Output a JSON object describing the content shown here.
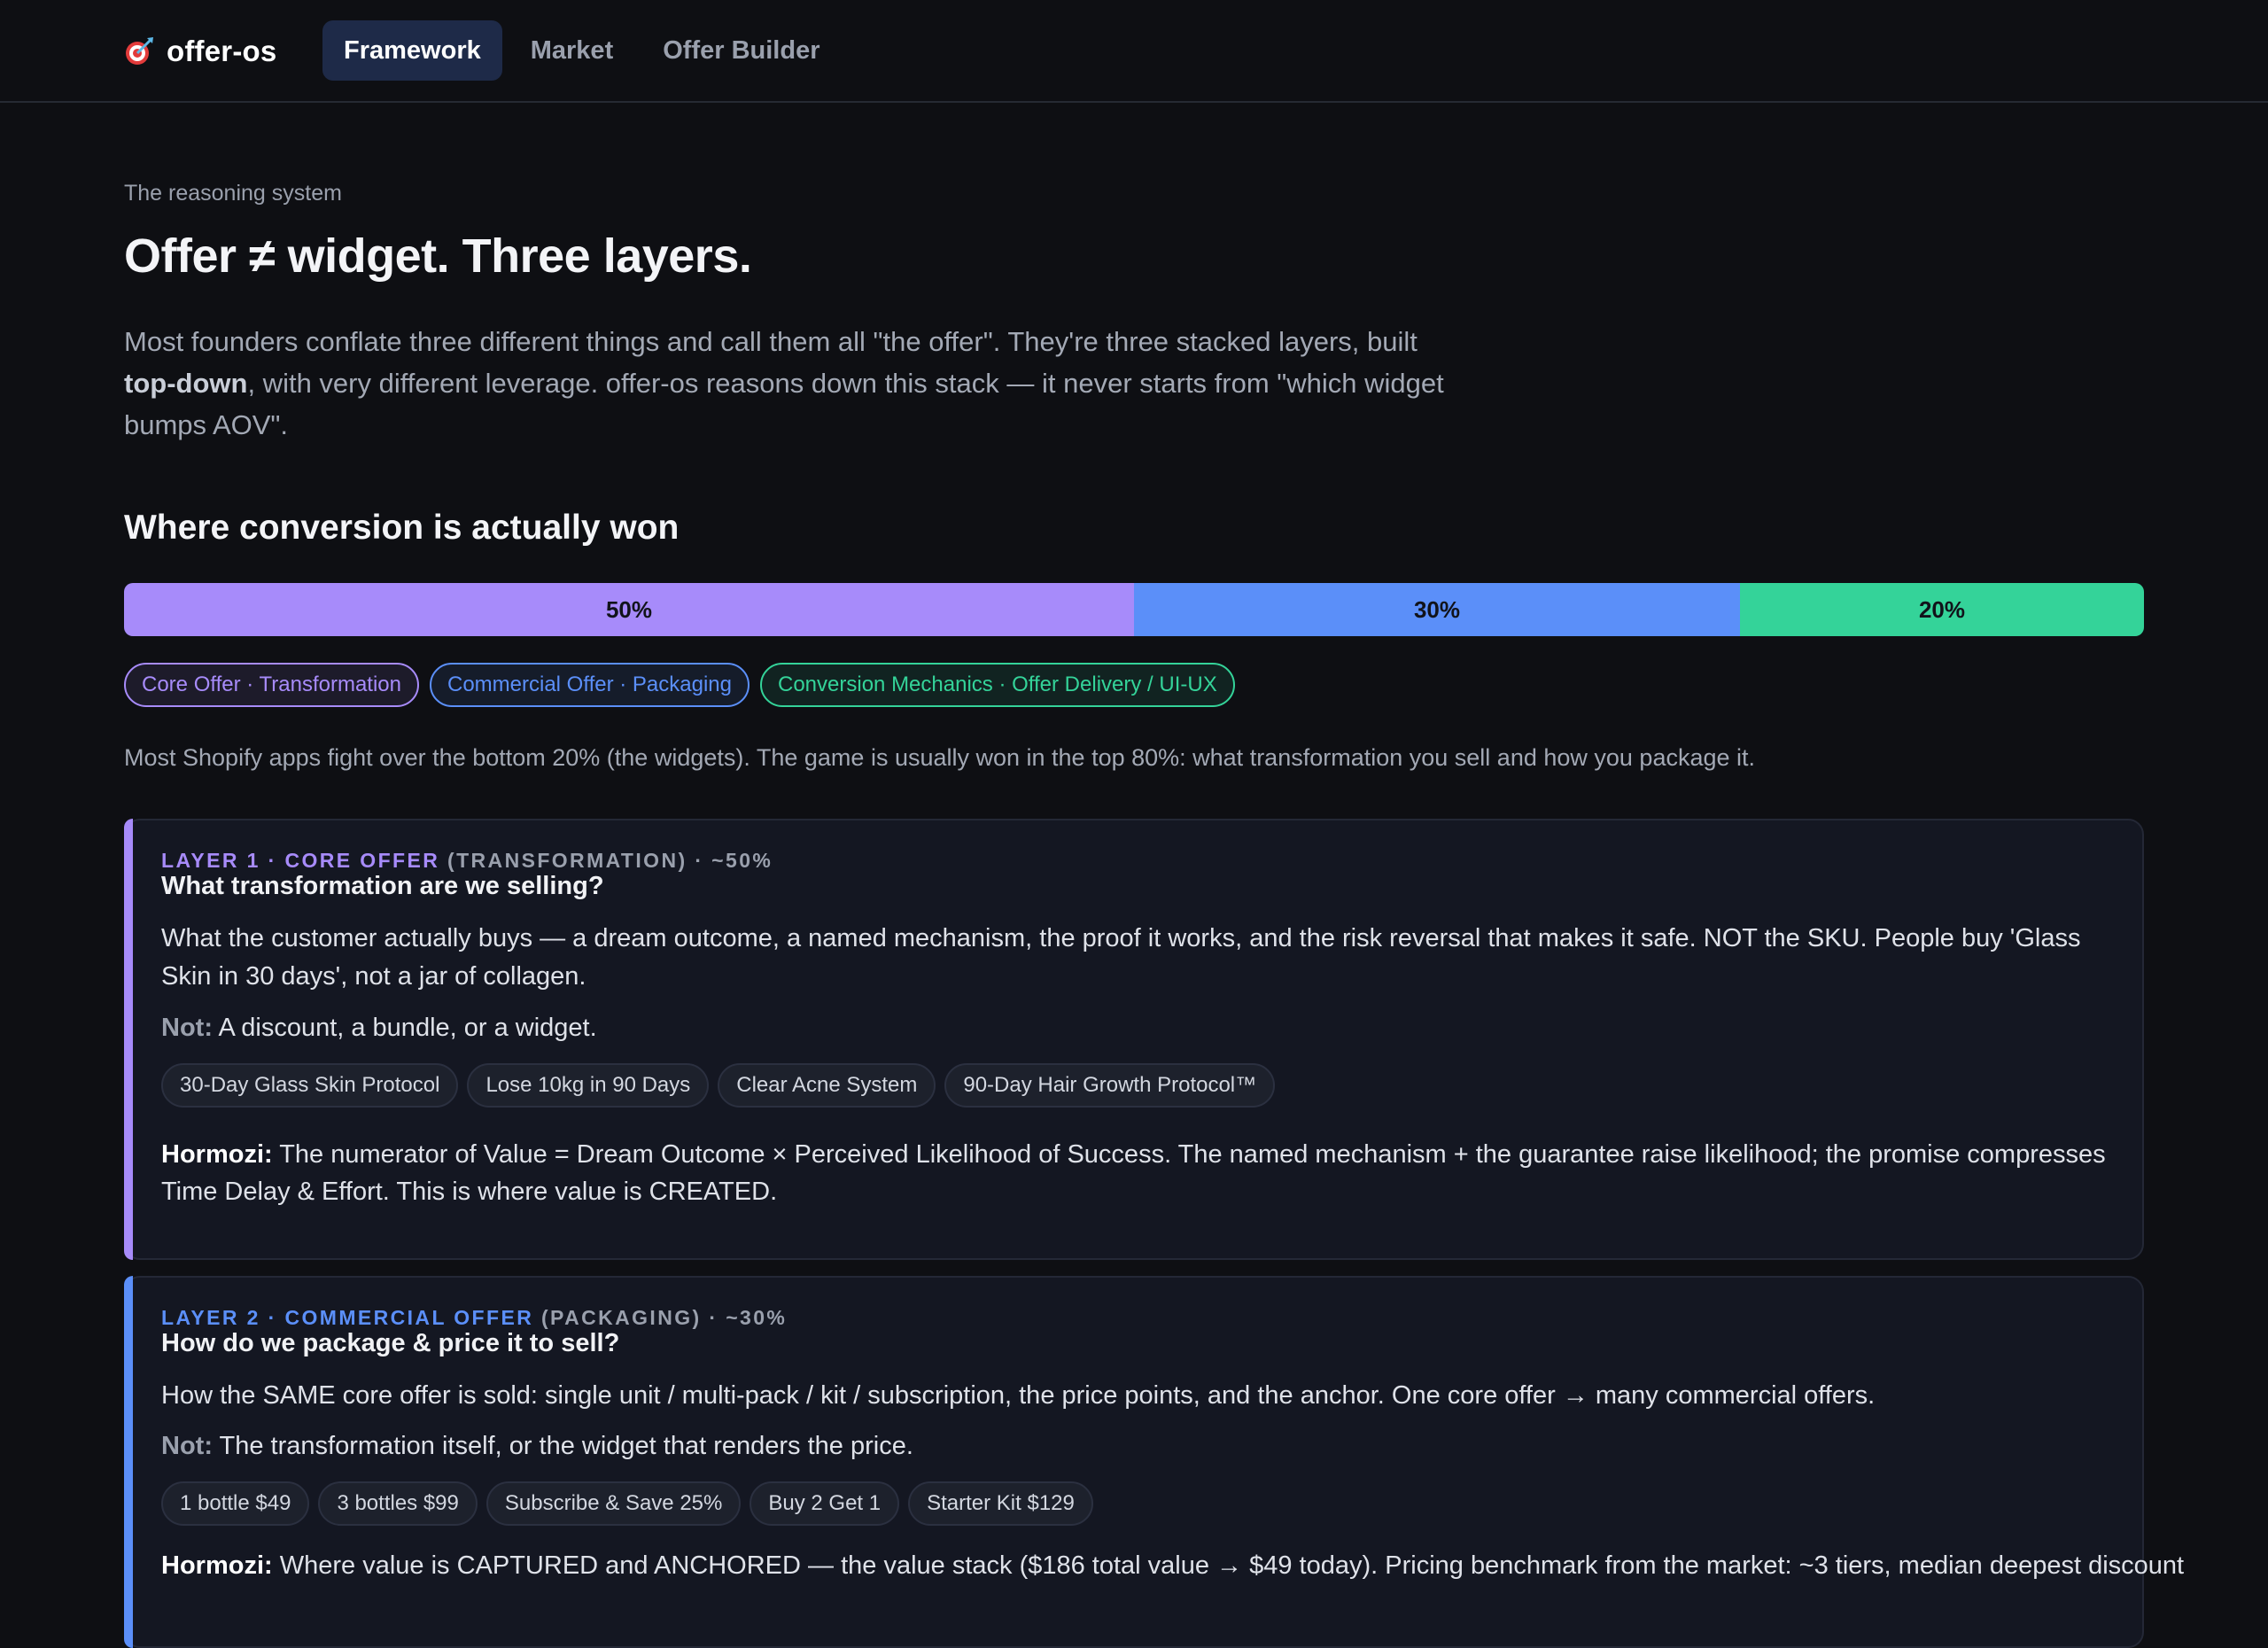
{
  "app": {
    "name": "offer-os",
    "tabs": [
      {
        "label": "Framework",
        "active": true
      },
      {
        "label": "Market",
        "active": false
      },
      {
        "label": "Offer Builder",
        "active": false
      }
    ]
  },
  "hero": {
    "eyebrow": "The reasoning system",
    "title": "Offer ≠ widget. Three layers.",
    "lede_part1": "Most founders conflate three different things and call them all \"the offer\". They're three stacked layers, built ",
    "lede_bold": "top-down",
    "lede_part2": ", with very different leverage. offer-os reasons down this stack — it never starts from \"which widget bumps AOV\"."
  },
  "conversion": {
    "title": "Where conversion is actually won",
    "segments": [
      {
        "label": "50%",
        "share": 0.5,
        "color": "#a78bfa"
      },
      {
        "label": "30%",
        "share": 0.3,
        "color": "#5b8ff9"
      },
      {
        "label": "20%",
        "share": 0.2,
        "color": "#34d399"
      }
    ],
    "legend": [
      {
        "label": "Core Offer · Transformation",
        "color": "#a78bfa"
      },
      {
        "label": "Commercial Offer · Packaging",
        "color": "#5b8ff9"
      },
      {
        "label": "Conversion Mechanics · Offer Delivery / UI-UX",
        "color": "#34d399"
      }
    ],
    "note": "Most Shopify apps fight over the bottom 20% (the widgets). The game is usually won in the top 80%: what transformation you sell and how you package it."
  },
  "layers": [
    {
      "color": "#a78bfa",
      "eyebrow_hl": "LAYER 1 · CORE OFFER",
      "eyebrow_rest": " (TRANSFORMATION) · ~50%",
      "question": "What transformation are we selling?",
      "body": "What the customer actually buys — a dream outcome, a named mechanism, the proof it works, and the risk reversal that makes it safe. NOT the SKU. People buy 'Glass Skin in 30 days', not a jar of collagen.",
      "not_label": "Not:",
      "not_text": " A discount, a bundle, or a widget.",
      "chips": [
        "30-Day Glass Skin Protocol",
        "Lose 10kg in 90 Days",
        "Clear Acne System",
        "90-Day Hair Growth Protocol™"
      ],
      "hormozi_label": "Hormozi:",
      "hormozi_text": " The numerator of Value = Dream Outcome × Perceived Likelihood of Success. The named mechanism + the guarantee raise likelihood; the promise compresses Time Delay & Effort. This is where value is CREATED."
    },
    {
      "color": "#5b8ff9",
      "eyebrow_hl": "LAYER 2 · COMMERCIAL OFFER",
      "eyebrow_rest": " (PACKAGING) · ~30%",
      "question": "How do we package & price it to sell?",
      "body": "How the SAME core offer is sold: single unit / multi-pack / kit / subscription, the price points, and the anchor. One core offer → many commercial offers.",
      "not_label": "Not:",
      "not_text": " The transformation itself, or the widget that renders the price.",
      "chips": [
        "1 bottle $49",
        "3 bottles $99",
        "Subscribe & Save 25%",
        "Buy 2 Get 1",
        "Starter Kit $129"
      ],
      "hormozi_label": "Hormozi:",
      "hormozi_text": " Where value is CAPTURED and ANCHORED — the value stack ($186 total value → $49 today). Pricing benchmark from the market: ~3 tiers, median deepest discount"
    }
  ]
}
